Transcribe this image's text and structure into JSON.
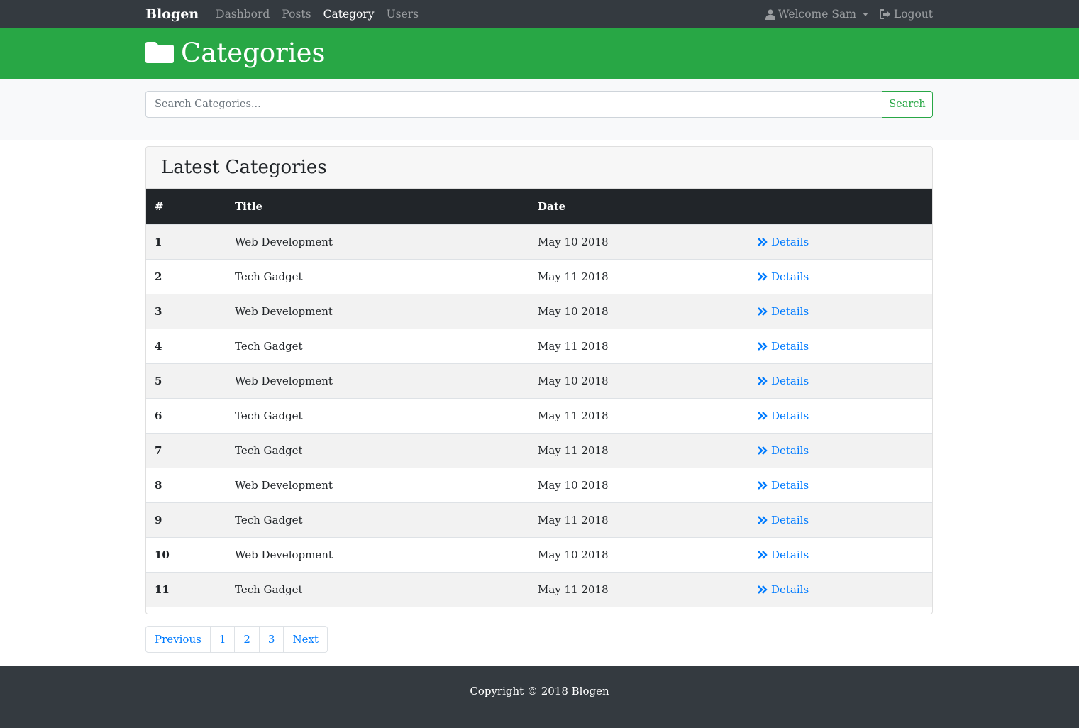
{
  "navbar": {
    "brand": "Blogen",
    "links": [
      {
        "label": "Dashbord",
        "active": false
      },
      {
        "label": "Posts",
        "active": false
      },
      {
        "label": "Category",
        "active": true
      },
      {
        "label": "Users",
        "active": false
      }
    ],
    "user_label": "Welcome Sam",
    "logout_label": "Logout"
  },
  "header": {
    "title": "Categories",
    "icon": "folder-icon",
    "color": "#28a745"
  },
  "search": {
    "placeholder": "Search Categories...",
    "button_label": "Search"
  },
  "card": {
    "title": "Latest Categories",
    "columns": [
      "#",
      "Title",
      "Date",
      ""
    ],
    "rows": [
      {
        "num": "1",
        "title": "Web Development",
        "date": "May 10 2018",
        "action": "Details"
      },
      {
        "num": "2",
        "title": "Tech Gadget",
        "date": "May 11 2018",
        "action": "Details"
      },
      {
        "num": "3",
        "title": "Web Development",
        "date": "May 10 2018",
        "action": "Details"
      },
      {
        "num": "4",
        "title": "Tech Gadget",
        "date": "May 11 2018",
        "action": "Details"
      },
      {
        "num": "5",
        "title": "Web Development",
        "date": "May 10 2018",
        "action": "Details"
      },
      {
        "num": "6",
        "title": "Tech Gadget",
        "date": "May 11 2018",
        "action": "Details"
      },
      {
        "num": "7",
        "title": "Tech Gadget",
        "date": "May 11 2018",
        "action": "Details"
      },
      {
        "num": "8",
        "title": "Web Development",
        "date": "May 10 2018",
        "action": "Details"
      },
      {
        "num": "9",
        "title": "Tech Gadget",
        "date": "May 11 2018",
        "action": "Details"
      },
      {
        "num": "10",
        "title": "Web Development",
        "date": "May 10 2018",
        "action": "Details"
      },
      {
        "num": "11",
        "title": "Tech Gadget",
        "date": "May 11 2018",
        "action": "Details"
      }
    ]
  },
  "pagination": {
    "previous": "Previous",
    "pages": [
      "1",
      "2",
      "3"
    ],
    "next": "Next"
  },
  "footer": {
    "text": "Copyright © 2018 Blogen"
  },
  "colors": {
    "navbar": "#343a40",
    "accent": "#28a745",
    "link": "#007bff",
    "table_head": "#212529"
  }
}
